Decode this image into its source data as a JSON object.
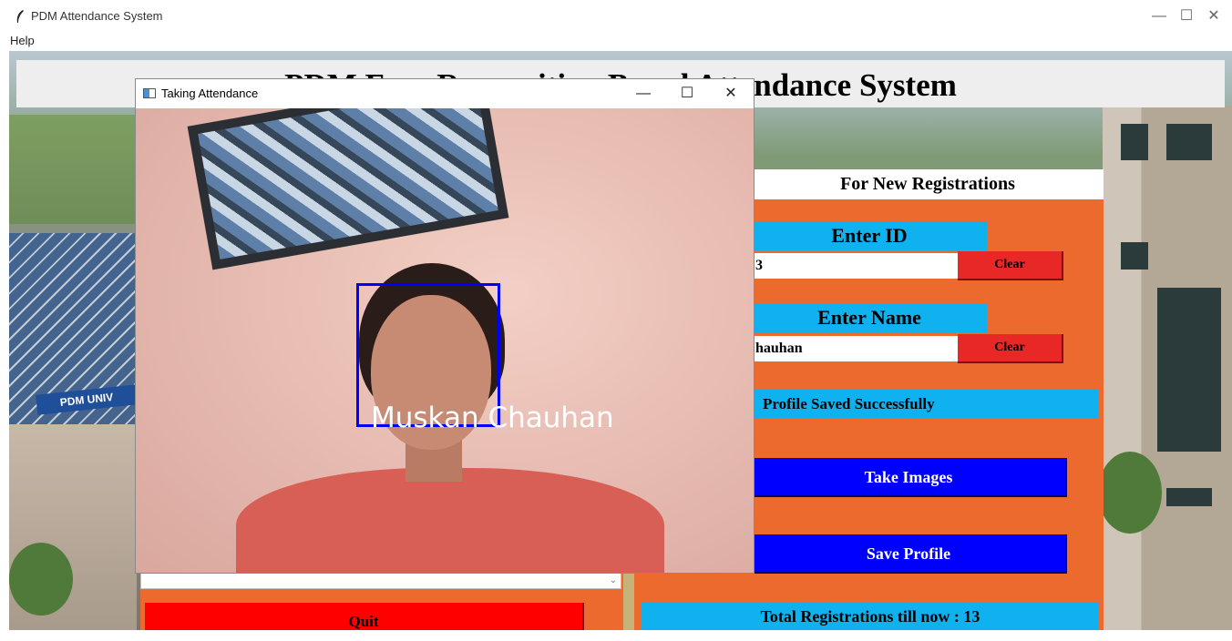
{
  "app": {
    "title": "PDM Attendance System",
    "menu": [
      "Help"
    ],
    "window_controls": [
      "—",
      "☐",
      "✕"
    ]
  },
  "banner": {
    "title": "PDM Face Recognition Based Attendance System"
  },
  "registration": {
    "header": "For New Registrations",
    "id_label": "Enter ID",
    "id_value": "3",
    "id_clear": "Clear",
    "name_label": "Enter Name",
    "name_value": "hauhan",
    "name_clear": "Clear",
    "status": "Profile Saved Successfully",
    "take_images": "Take Images",
    "save_profile": "Save Profile",
    "total": "Total Registrations till now  : 13"
  },
  "attendance": {
    "quit": "Quit"
  },
  "camera_window": {
    "title": "Taking Attendance",
    "controls": [
      "—",
      "☐",
      "✕"
    ],
    "detected_name": "Muskan  Chauhan"
  },
  "colors": {
    "panel_orange": "#ec6a2d",
    "label_cyan": "#0fb1ef",
    "button_blue": "#0000ff",
    "clear_red": "#e82727",
    "quit_red": "#ff0000"
  }
}
